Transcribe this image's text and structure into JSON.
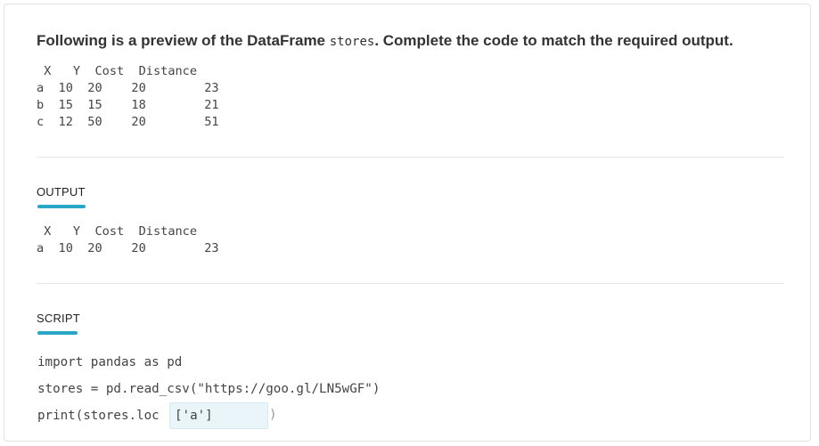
{
  "question": {
    "prefix": "Following is a preview of the DataFrame",
    "var_name": "stores",
    "suffix": ". Complete the code to match the required output."
  },
  "preview_table": " X   Y  Cost  Distance\na  10  20    20        23\nb  15  15    18        21\nc  12  50    20        51",
  "output": {
    "label": "OUTPUT",
    "table": " X   Y  Cost  Distance\na  10  20    20        23"
  },
  "script": {
    "label": "SCRIPT",
    "line1": "import pandas as pd",
    "line2": "stores = pd.read_csv(\"https://goo.gl/LN5wGF\")",
    "line3_prefix": "print(stores.loc",
    "blank_value": "['a']",
    "line3_suffix": ")"
  },
  "colors": {
    "accent": "#2aa7c6",
    "blank_bg": "#eaf5fa"
  }
}
